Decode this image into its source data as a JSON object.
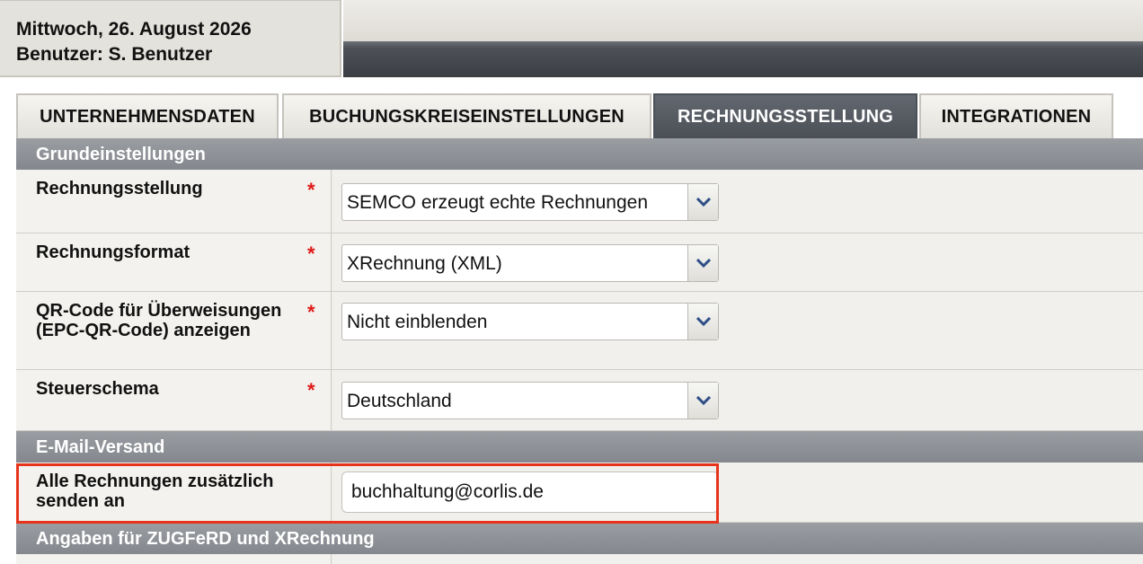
{
  "header": {
    "date": "Mittwoch, 26. August 2026",
    "user": "Benutzer: S. Benutzer"
  },
  "tabs": [
    {
      "label": "UNTERNEHMENSDATEN",
      "active": false
    },
    {
      "label": "BUCHUNGSKREISEINSTELLUNGEN",
      "active": false
    },
    {
      "label": "RECHNUNGSSTELLUNG",
      "active": true
    },
    {
      "label": "INTEGRATIONEN",
      "active": false
    }
  ],
  "sections": {
    "grundeinstellungen": "Grundeinstellungen",
    "email": "E-Mail-Versand",
    "zugferd": "Angaben für ZUGFeRD und XRechnung"
  },
  "fields": {
    "required_marker": "*",
    "rechnungsstellung": {
      "label": "Rechnungsstellung",
      "value": "SEMCO erzeugt echte Rechnungen"
    },
    "rechnungsformat": {
      "label": "Rechnungsformat",
      "value": "XRechnung (XML)"
    },
    "qr_code": {
      "label": "QR-Code für Überweisungen (EPC-QR-Code) anzeigen",
      "value": "Nicht einblenden"
    },
    "steuerschema": {
      "label": "Steuerschema",
      "value": "Deutschland"
    },
    "email_cc": {
      "label": "Alle Rechnungen zusätzlich senden an",
      "value": "buchhaltung@corlis.de"
    }
  },
  "colors": {
    "active_tab": "#4b4f56",
    "section_header": "#8a8d93",
    "required": "#e01818",
    "highlight": "#e8331c"
  },
  "icons": {
    "select_arrow": "chevron-down-icon"
  }
}
